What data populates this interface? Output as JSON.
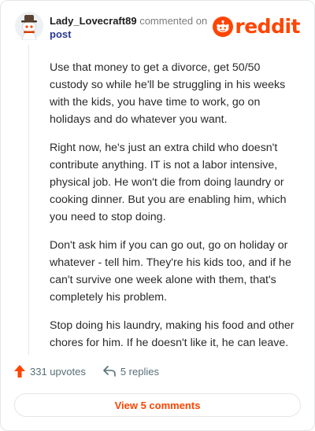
{
  "comment": {
    "username": "Lady_Lovecraft89",
    "action_text": "commented on",
    "target": "post",
    "paragraphs": [
      "Use that money to get a divorce, get 50/50 custody so while he'll be struggling in his weeks with the kids, you have time to work, go on holidays and do whatever you want.",
      "Right now, he's just an extra child who doesn't contribute anything. IT is not a labor intensive, physical job. He won't die from doing laundry or cooking dinner. But you are enabling him, which you need to stop doing.",
      "Don't ask him if you can go out, go on holiday or whatever - tell him. They're his kids too, and if he can't survive one week alone with them, that's completely his problem.",
      "Stop doing his laundry, making his food and other chores for him. If he doesn't like it, he can leave."
    ]
  },
  "brand": {
    "name": "reddit",
    "color": "#ff4500"
  },
  "actions": {
    "upvotes_label": "331 upvotes",
    "replies_label": "5 replies",
    "view_comments_label": "View 5 comments"
  },
  "icons": [
    "avatar",
    "reddit-snoo-icon",
    "upvote-arrow-icon",
    "reply-arrow-icon"
  ]
}
